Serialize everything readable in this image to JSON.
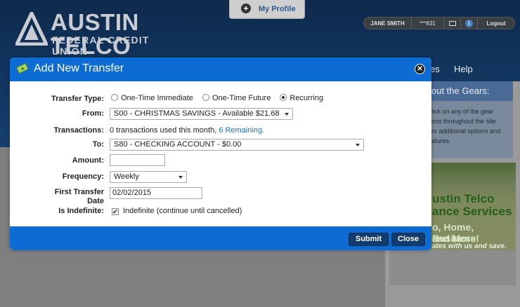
{
  "bank": {
    "name": "AUSTIN TELCO",
    "subtitle": "FEDERAL CREDIT UNION"
  },
  "profile_tab": {
    "label": "My Profile",
    "icon": "plus-circle-icon"
  },
  "user_bar": {
    "user_name": "JANE SMITH",
    "account_mask": "***831",
    "logout_label": "Logout"
  },
  "nav": {
    "partial_item": "es",
    "help": "Help"
  },
  "sidebar": {
    "gears_title": "out the Gears:",
    "gears_lines": [
      "lick on any of the gear",
      "ons throughout the site",
      "or additional options and",
      "atures."
    ],
    "ad_lines": [
      "ustin Telco",
      "ance Services",
      "o, Home, Business",
      "and More!",
      "ates with us and save."
    ]
  },
  "modal": {
    "title": "Add New Transfer",
    "transfer_type": {
      "label": "Transfer Type:",
      "options": [
        "One-Time Immediate",
        "One-Time Future",
        "Recurring"
      ],
      "selected": "Recurring"
    },
    "from": {
      "label": "From:",
      "value": "S00 - CHRISTMAS SAVINGS - Available $21.68"
    },
    "transactions": {
      "label": "Transactions:",
      "text": "0 transactions used this month,",
      "link": "6 Remaining."
    },
    "to": {
      "label": "To:",
      "value": "S80 - CHECKING ACCOUNT - $0.00"
    },
    "amount": {
      "label": "Amount:",
      "value": ""
    },
    "frequency": {
      "label": "Frequency:",
      "value": "Weekly"
    },
    "first_date": {
      "label_line1": "First Transfer",
      "label_line2": "Date",
      "value": "02/02/2015"
    },
    "indefinite": {
      "label": "Is Indefinite:",
      "checkbox_label": "Indefinite (continue until cancelled)",
      "checked": true
    },
    "buttons": {
      "submit": "Submit",
      "close": "Close"
    }
  },
  "colors": {
    "modal_blue": "#0d6bd4",
    "button_navy": "#123c6d",
    "link_blue": "#1a6fc4",
    "header_navy": "#123660"
  }
}
